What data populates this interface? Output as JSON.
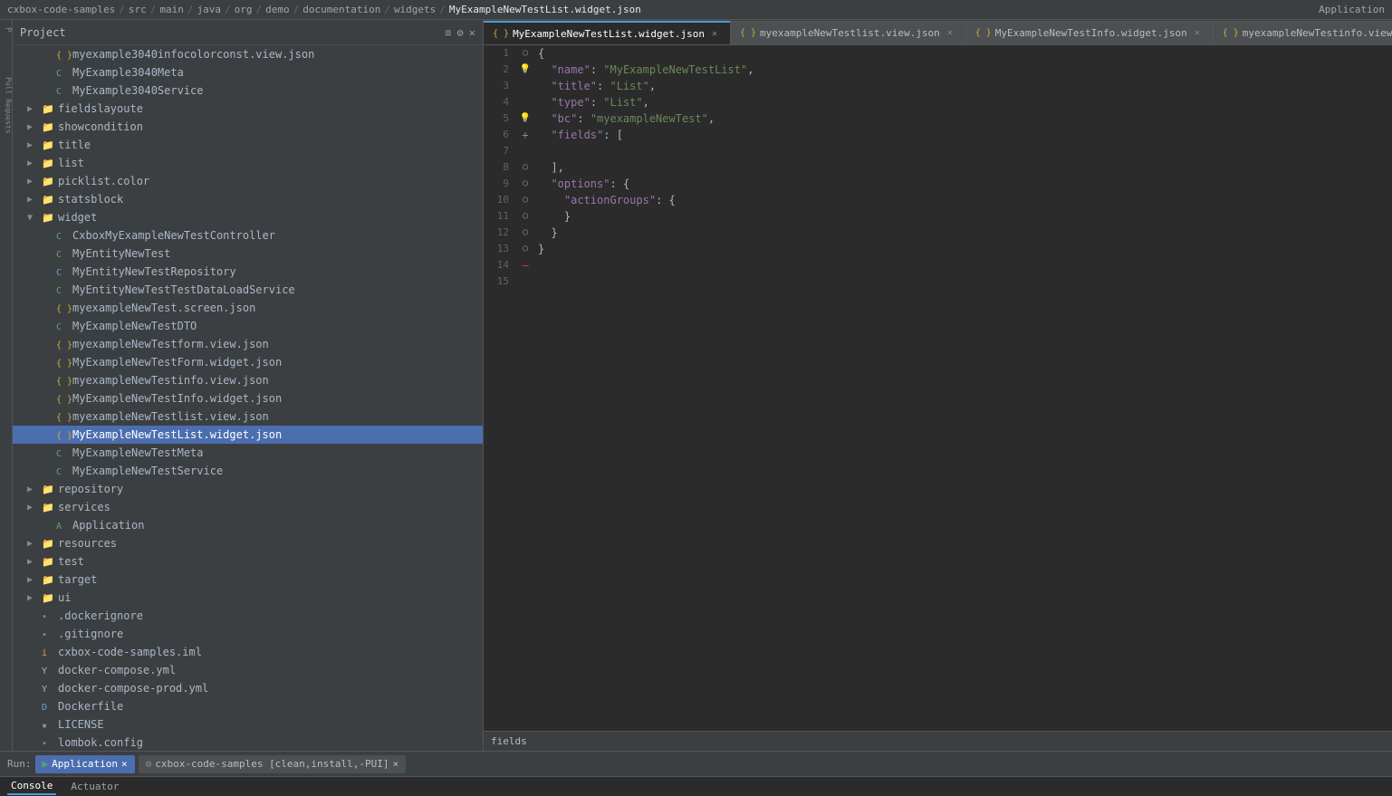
{
  "topbar": {
    "breadcrumb": [
      "cxbox-code-samples",
      "src",
      "main",
      "java",
      "org",
      "demo",
      "documentation",
      "widgets"
    ],
    "active_file": "MyExampleNewTestList.widget.json",
    "app_label": "Application"
  },
  "sidebar": {
    "title": "Project",
    "items": [
      {
        "id": "myexample3040info",
        "label": "myexample3040infocolorconst.view.json",
        "indent": 2,
        "icon": "json",
        "type": "file"
      },
      {
        "id": "MyExample3040Meta",
        "label": "MyExample3040Meta",
        "indent": 2,
        "icon": "class",
        "type": "file"
      },
      {
        "id": "MyExample3040Service",
        "label": "MyExample3040Service",
        "indent": 2,
        "icon": "class",
        "type": "file"
      },
      {
        "id": "fieldslayoute",
        "label": "fieldslayoute",
        "indent": 1,
        "icon": "folder",
        "type": "folder",
        "collapsed": true
      },
      {
        "id": "showcondition",
        "label": "showcondition",
        "indent": 1,
        "icon": "folder",
        "type": "folder",
        "collapsed": true
      },
      {
        "id": "title",
        "label": "title",
        "indent": 1,
        "icon": "folder",
        "type": "folder",
        "collapsed": true
      },
      {
        "id": "list",
        "label": "list",
        "indent": 1,
        "icon": "folder",
        "type": "folder",
        "collapsed": true
      },
      {
        "id": "picklist_color",
        "label": "picklist.color",
        "indent": 1,
        "icon": "folder",
        "type": "folder",
        "collapsed": true
      },
      {
        "id": "statsblock",
        "label": "statsblock",
        "indent": 1,
        "icon": "folder",
        "type": "folder",
        "collapsed": true
      },
      {
        "id": "widget",
        "label": "widget",
        "indent": 1,
        "icon": "folder",
        "type": "folder",
        "collapsed": false
      },
      {
        "id": "CxboxMyExampleNewTestController",
        "label": "CxboxMyExampleNewTestController",
        "indent": 2,
        "icon": "class",
        "type": "file"
      },
      {
        "id": "MyEntityNewTest",
        "label": "MyEntityNewTest",
        "indent": 2,
        "icon": "class",
        "type": "file"
      },
      {
        "id": "MyEntityNewTestRepository",
        "label": "MyEntityNewTestRepository",
        "indent": 2,
        "icon": "class-blue",
        "type": "file"
      },
      {
        "id": "MyEntityNewTestTestDataLoadService",
        "label": "MyEntityNewTestTestDataLoadService",
        "indent": 2,
        "icon": "class",
        "type": "file"
      },
      {
        "id": "myexampleNewTest_screen",
        "label": "myexampleNewTest.screen.json",
        "indent": 2,
        "icon": "json",
        "type": "file"
      },
      {
        "id": "MyExampleNewTestDTO",
        "label": "MyExampleNewTestDTO",
        "indent": 2,
        "icon": "class",
        "type": "file"
      },
      {
        "id": "myexamplenewTestform_view",
        "label": "myexampleNewTestform.view.json",
        "indent": 2,
        "icon": "json",
        "type": "file"
      },
      {
        "id": "MyExampleNewTestForm_widget",
        "label": "MyExampleNewTestForm.widget.json",
        "indent": 2,
        "icon": "json",
        "type": "file"
      },
      {
        "id": "myexampleNewTestinfo_view",
        "label": "myexampleNewTestinfo.view.json",
        "indent": 2,
        "icon": "json",
        "type": "file"
      },
      {
        "id": "MyExampleNewTestInfo_widget",
        "label": "MyExampleNewTestInfo.widget.json",
        "indent": 2,
        "icon": "json",
        "type": "file"
      },
      {
        "id": "myexampleNewTestlist_view",
        "label": "myexampleNewTestlist.view.json",
        "indent": 2,
        "icon": "json",
        "type": "file"
      },
      {
        "id": "MyExampleNewTestList_widget",
        "label": "MyExampleNewTestList.widget.json",
        "indent": 2,
        "icon": "json",
        "type": "file",
        "selected": true
      },
      {
        "id": "MyExampleNewTestMeta",
        "label": "MyExampleNewTestMeta",
        "indent": 2,
        "icon": "class",
        "type": "file"
      },
      {
        "id": "MyExampleNewTestService",
        "label": "MyExampleNewTestService",
        "indent": 2,
        "icon": "class",
        "type": "file"
      },
      {
        "id": "repository",
        "label": "repository",
        "indent": 1,
        "icon": "folder",
        "type": "folder",
        "collapsed": true
      },
      {
        "id": "services",
        "label": "services",
        "indent": 1,
        "icon": "folder",
        "type": "folder",
        "collapsed": true
      },
      {
        "id": "Application",
        "label": "Application",
        "indent": 2,
        "icon": "app",
        "type": "file"
      },
      {
        "id": "resources",
        "label": "resources",
        "indent": 1,
        "icon": "folder",
        "type": "folder",
        "collapsed": true
      },
      {
        "id": "test",
        "label": "test",
        "indent": 1,
        "icon": "folder",
        "type": "folder",
        "collapsed": true
      },
      {
        "id": "target",
        "label": "target",
        "indent": 1,
        "icon": "folder-orange",
        "type": "folder",
        "collapsed": true
      },
      {
        "id": "ui",
        "label": "ui",
        "indent": 1,
        "icon": "folder",
        "type": "folder",
        "collapsed": true
      },
      {
        "id": "dockerignore",
        "label": ".dockerignore",
        "indent": 1,
        "icon": "config",
        "type": "file"
      },
      {
        "id": "gitignore",
        "label": ".gitignore",
        "indent": 1,
        "icon": "config",
        "type": "file"
      },
      {
        "id": "cxbox_iml",
        "label": "cxbox-code-samples.iml",
        "indent": 1,
        "icon": "iml",
        "type": "file"
      },
      {
        "id": "docker_compose",
        "label": "docker-compose.yml",
        "indent": 1,
        "icon": "yaml",
        "type": "file"
      },
      {
        "id": "docker_compose_prod",
        "label": "docker-compose-prod.yml",
        "indent": 1,
        "icon": "yaml",
        "type": "file"
      },
      {
        "id": "Dockerfile",
        "label": "Dockerfile",
        "indent": 1,
        "icon": "docker",
        "type": "file"
      },
      {
        "id": "LICENSE",
        "label": "LICENSE",
        "indent": 1,
        "icon": "text",
        "type": "file"
      },
      {
        "id": "lombok_config",
        "label": "lombok.config",
        "indent": 1,
        "icon": "config",
        "type": "file"
      }
    ]
  },
  "tabs": [
    {
      "id": "tab1",
      "label": "MyExampleNewTestList.widget.json",
      "active": true,
      "icon": "json"
    },
    {
      "id": "tab2",
      "label": "myexampleNewTestlist.view.json",
      "active": false,
      "icon": "json"
    },
    {
      "id": "tab3",
      "label": "MyExampleNewTestInfo.widget.json",
      "active": false,
      "icon": "json"
    },
    {
      "id": "tab4",
      "label": "myexampleNewTestinfo.view.json",
      "active": false,
      "icon": "json"
    },
    {
      "id": "tab5",
      "label": "My...",
      "active": false,
      "icon": "json"
    }
  ],
  "code": {
    "lines": [
      {
        "num": 1,
        "content": "{",
        "gutter": "circle"
      },
      {
        "num": 2,
        "content": "  \"name\": \"MyExampleNewTestList\",",
        "gutter": "bulb"
      },
      {
        "num": 3,
        "content": "  \"title\": \"List\",",
        "gutter": ""
      },
      {
        "num": 4,
        "content": "  \"type\": \"List\",",
        "gutter": ""
      },
      {
        "num": 5,
        "content": "  \"bc\": \"myexampleNewTest\",",
        "gutter": "bulb"
      },
      {
        "num": 6,
        "content": "  \"fields\": [",
        "gutter": "plus"
      },
      {
        "num": 7,
        "content": "",
        "gutter": ""
      },
      {
        "num": 8,
        "content": "  ],",
        "gutter": "circle"
      },
      {
        "num": 9,
        "content": "  \"options\": {",
        "gutter": "circle"
      },
      {
        "num": 10,
        "content": "    \"actionGroups\": {",
        "gutter": "circle"
      },
      {
        "num": 11,
        "content": "    }",
        "gutter": "circle"
      },
      {
        "num": 12,
        "content": "  }",
        "gutter": "circle"
      },
      {
        "num": 13,
        "content": "}",
        "gutter": "circle"
      },
      {
        "num": 14,
        "content": "",
        "gutter": "red"
      },
      {
        "num": 15,
        "content": "",
        "gutter": ""
      }
    ]
  },
  "statusbar": {
    "fields_hint": "fields"
  },
  "runbar": {
    "run_label": "Run:",
    "app_label": "Application",
    "app_close": "×",
    "build_label": "cxbox-code-samples [clean,install,-PUI]",
    "build_close": "×"
  },
  "consolebar": {
    "tabs": [
      "Console",
      "Actuator"
    ]
  }
}
